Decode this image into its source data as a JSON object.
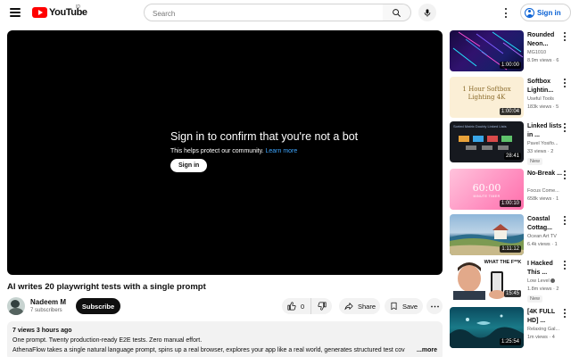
{
  "header": {
    "logo_text": "YouTube",
    "logo_country": "ID",
    "search_placeholder": "Search",
    "signin_label": "Sign in"
  },
  "player": {
    "message_title": "Sign in to confirm that you're not a bot",
    "message_sub": "This helps protect our community.",
    "learn_more": "Learn more",
    "signin_label": "Sign in"
  },
  "video": {
    "title": "AI writes 20 playwright tests with a single prompt",
    "channel_name": "Nadeem M",
    "subscribers": "7 subscribers",
    "subscribe_label": "Subscribe",
    "likes": "0",
    "share_label": "Share",
    "save_label": "Save",
    "description_meta": "7 views  3 hours ago",
    "description_line1": "One prompt. Twenty production-ready E2E tests. Zero manual effort.",
    "description_line2": "AthenaFlow takes a single natural language prompt, spins up a real browser, explores your app like a real world, generates structured test cov",
    "more_label": "...more"
  },
  "recommendations": [
    {
      "title": "Rounded Neon...",
      "channel": "MG1010",
      "views": "8.9m views · 6",
      "duration": "1:00:00",
      "new": ""
    },
    {
      "title": "Softbox Lightin...",
      "channel": "Useful Tools",
      "views": "183k views · 5",
      "duration": "1:00:04",
      "new": "",
      "thumb_text": "1 Hour Softbox Lighting 4K"
    },
    {
      "title": "Linked lists in ...",
      "channel": "Pavel Yosifo...",
      "views": "33 views · 2",
      "duration": "28:41",
      "new": "New",
      "thumb_text": "Sorted Matrix Doubly Linked Lists"
    },
    {
      "title": "No-Break ...",
      "channel": "Focus Come...",
      "views": "658k views · 1",
      "duration": "1:00:10",
      "new": "",
      "thumb_text": "60:00",
      "thumb_sub": "MINUTE TIMER"
    },
    {
      "title": "Coastal Cottag...",
      "channel": "Ocean Art TV",
      "views": "6.4k views · 1",
      "duration": "1:11:12",
      "new": ""
    },
    {
      "title": "I Hacked This ...",
      "channel": "Low Level",
      "views": "1.8m views · 2",
      "duration": "15:45",
      "new": "New",
      "thumb_text": "WHAT THE F**K"
    },
    {
      "title": "[4K FULL HD] ...",
      "channel": "Relaxing Gal...",
      "views": "1m views · 4",
      "duration": "1:25:54",
      "new": ""
    }
  ],
  "colors": {
    "accent_red": "#ff0000",
    "link_blue": "#065fd4",
    "text": "#0f0f0f",
    "muted": "#606060"
  }
}
